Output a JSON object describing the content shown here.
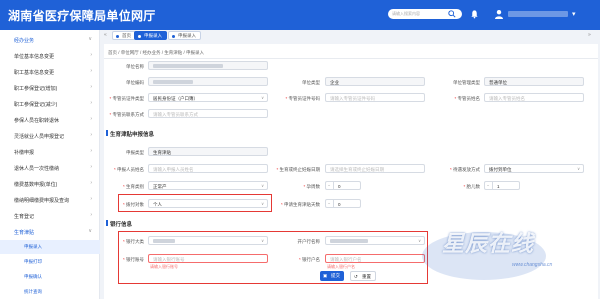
{
  "app": {
    "title": "湖南省医疗保障局单位网厅"
  },
  "header": {
    "search_placeholder": "请输入搜索内容"
  },
  "sidebar": {
    "items": [
      {
        "label": "经办业务"
      },
      {
        "label": "单位基本信息变更"
      },
      {
        "label": "职工基本信息变更"
      },
      {
        "label": "职工参保登记(增加)"
      },
      {
        "label": "职工参保登记(减少)"
      },
      {
        "label": "参保人员在职转退休"
      },
      {
        "label": "灵活就业人员申报登记"
      },
      {
        "label": "补缴申报"
      },
      {
        "label": "退休人员一次性缴纳"
      },
      {
        "label": "缴费基数申报(单位)"
      },
      {
        "label": "缴纳明细缴费申报及查询"
      },
      {
        "label": "生育登记"
      },
      {
        "label": "生育津贴"
      }
    ],
    "subitems": [
      {
        "label": "申报录入"
      },
      {
        "label": "申报打印"
      },
      {
        "label": "申报确认"
      },
      {
        "label": "统计查询"
      }
    ]
  },
  "tabs": [
    {
      "label": "首页"
    },
    {
      "label": "申报录入"
    },
    {
      "label": "申报录入"
    }
  ],
  "breadcrumb": "首页  /  单位网厅  /  经办业务  /  生育津贴  /  申报录入",
  "form": {
    "unit_name_label": "单位名称",
    "unit_code_label": "单位编码",
    "unit_type_label": "单位类型",
    "unit_type_value": "企业",
    "unit_mgmt_label": "单位管理类型",
    "unit_mgmt_value": "普通单位",
    "id_type_label": "专管员证件类型",
    "id_type_value": "居民身份证（户口簿）",
    "id_no_label": "专管员证件号码",
    "id_no_ph": "请输入专管员证件号码",
    "name_label": "专管员姓名",
    "name_ph": "请输入专管员姓名",
    "contact_label": "专管员联系方式",
    "contact_ph": "请输入专管员联系方式"
  },
  "section_birth": {
    "title": "生育津贴申报信息",
    "apply_type_label": "申报类型",
    "apply_type_value": "生育津贴",
    "person_label": "申报人员姓名",
    "person_ph": "请输入申报人员姓名",
    "birth_date_label": "生育或终止妊娠日期",
    "birth_date_ph": "请选择生育或终止妊娠日期",
    "birth_mode_label": "待遇发放方式",
    "birth_mode_value": "拨付到单位",
    "category_label": "生育类别",
    "category_value": "正常产",
    "weeks_label": "孕周数",
    "weeks_value": "0",
    "babies_label": "胎儿数",
    "babies_value": "1",
    "pay_target_label": "拨付对象",
    "pay_target_value": "个人",
    "months_label": "申请生育津贴天数",
    "months_value": "0"
  },
  "section_bank": {
    "title": "银行信息",
    "bank_label": "银行大类",
    "account_name_label": "开户行名称",
    "account_no_label": "银行账号",
    "account_no_ph": "请输入银行账号",
    "account_no_err": "请输入银行账号",
    "holder_label": "银行户名",
    "holder_ph": "请输入银行户名",
    "holder_err": "请输入银行户名"
  },
  "buttons": {
    "submit": "提交",
    "reset": "重置"
  },
  "watermark": {
    "text": "星辰在线",
    "url": "www.changsha.cn"
  },
  "colors": {
    "brand": "#1f61d7",
    "error": "#e53935",
    "watermark_blue": "#3c6ec8"
  }
}
